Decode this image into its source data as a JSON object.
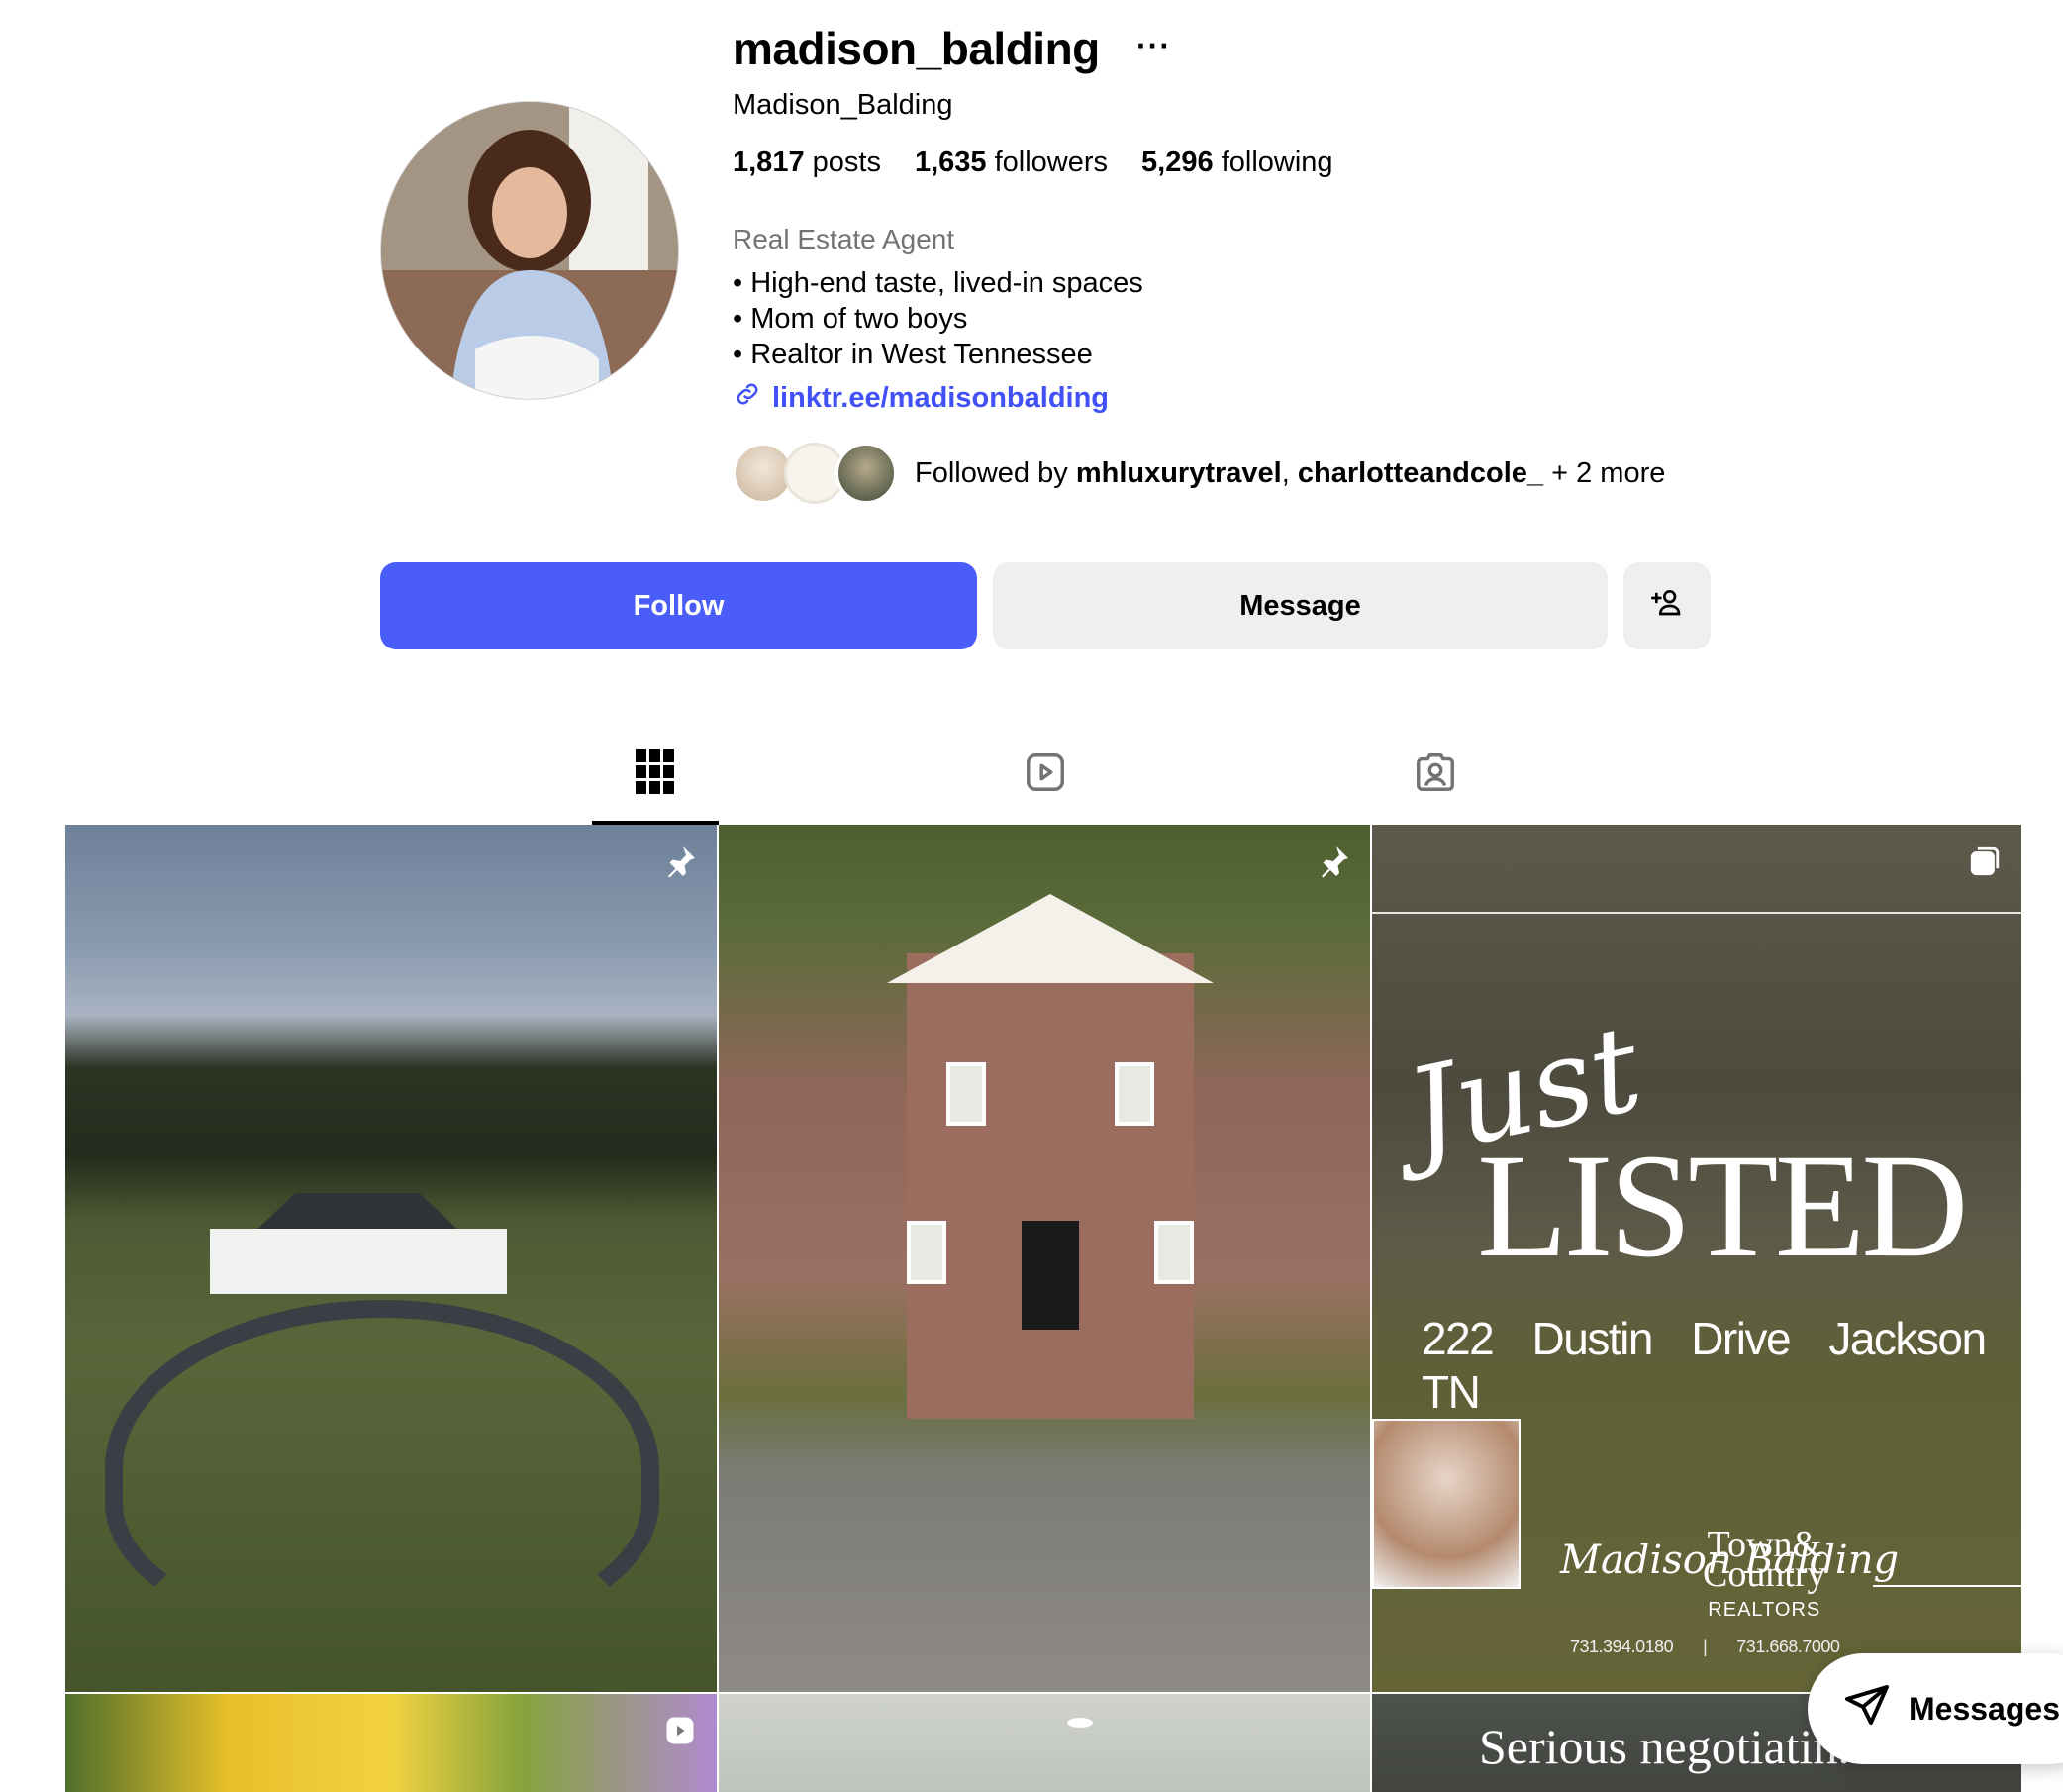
{
  "profile": {
    "username": "madison_balding",
    "more": "···",
    "full_name": "Madison_Balding",
    "stats": {
      "posts_count": "1,817",
      "posts_label": "posts",
      "followers_count": "1,635",
      "followers_label": "followers",
      "following_count": "5,296",
      "following_label": "following"
    },
    "category": "Real Estate Agent",
    "bio": [
      "High-end taste, lived-in spaces",
      "Mom of two boys",
      "Realtor in West Tennessee"
    ],
    "link": "linktr.ee/madisonbalding",
    "followed_by": {
      "prefix": "Followed by ",
      "user1": "mhluxurytravel",
      "sep": ", ",
      "user2": "charlotteandcole_",
      "suffix": " + 2 more"
    }
  },
  "actions": {
    "follow": "Follow",
    "message": "Message"
  },
  "tabs": [
    {
      "name": "posts",
      "icon": "grid-icon",
      "active": true
    },
    {
      "name": "reels",
      "icon": "reels-icon",
      "active": false
    },
    {
      "name": "tagged",
      "icon": "tagged-icon",
      "active": false
    }
  ],
  "posts": {
    "listing": {
      "script": "Just",
      "headline": "LISTED",
      "address": "222 Dustin Drive Jackson TN",
      "signature": "Madison Balding",
      "brand_line1": "Town&",
      "brand_line2": "Country",
      "brand_sub": "REALTORS",
      "phone1": "731.394.0180",
      "divider": "|",
      "phone2": "731.668.7000"
    },
    "negotiation_text": "Serious negotiatin..."
  },
  "messages_label": "Messages",
  "colors": {
    "follow_button": "#4a5df9",
    "link": "#4150f7",
    "secondary_button": "#efefef"
  }
}
